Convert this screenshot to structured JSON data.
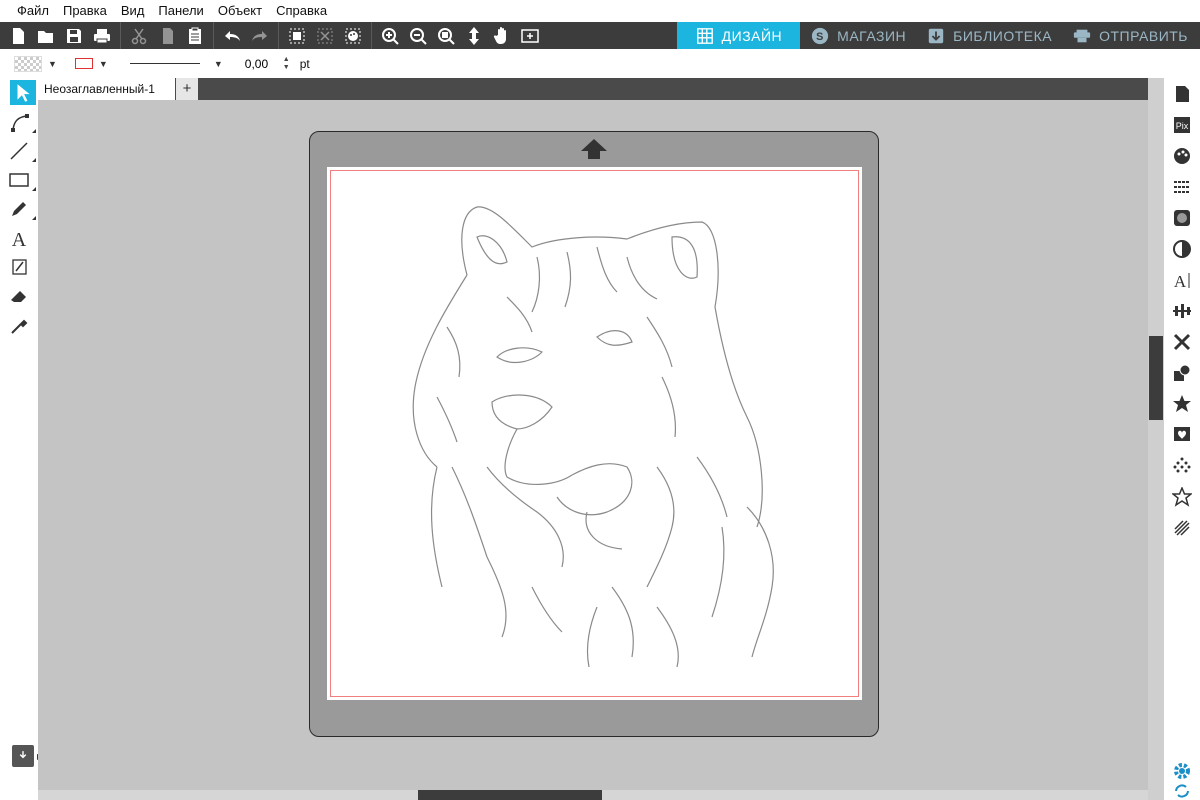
{
  "menu": [
    "Файл",
    "Правка",
    "Вид",
    "Панели",
    "Объект",
    "Справка"
  ],
  "toolbar": {
    "groups": [
      [
        "new-icon",
        "open-icon",
        "save-icon",
        "print-icon"
      ],
      [
        "cut-icon",
        "copy-icon",
        "paste-icon"
      ],
      [
        "undo-icon",
        "redo-icon"
      ],
      [
        "group-icon",
        "ungroup-icon",
        "fill-color-icon"
      ],
      [
        "zoom-in-icon",
        "zoom-out-icon",
        "zoom-select-icon",
        "drag-icon",
        "pan-icon",
        "fit-page-icon"
      ]
    ],
    "nav_tabs": [
      {
        "id": "design",
        "label": "ДИЗАЙН",
        "icon": "grid-icon",
        "active": true
      },
      {
        "id": "store",
        "label": "МАГАЗИН",
        "icon": "store-icon",
        "active": false
      },
      {
        "id": "library",
        "label": "БИБЛИОТЕКА",
        "icon": "library-icon",
        "active": false
      },
      {
        "id": "send",
        "label": "ОТПРАВИТЬ",
        "icon": "cutter-icon",
        "active": false
      }
    ],
    "active_color": "#1bb5e0"
  },
  "properties": {
    "line_width": "0,00",
    "unit": "pt",
    "line_color": "#e03030"
  },
  "document": {
    "tab_title": "Неозаглавленный-1",
    "add_tab": "+"
  },
  "left_tools": [
    "select-icon",
    "edit-points-icon",
    "line-icon",
    "rectangle-icon",
    "pencil-icon",
    "text-icon",
    "knife-icon",
    "eraser-icon",
    "eyedropper-icon"
  ],
  "right_panels": [
    "page-setup-icon",
    "pixscan-icon",
    "fill-panel-icon",
    "line-style-icon",
    "pattern-icon",
    "trace-icon",
    "text-style-icon",
    "align-icon",
    "replicate-icon",
    "modify-icon",
    "offset-icon",
    "trace-panel-icon",
    "rhinestone-icon",
    "sketch-icon",
    "emboss-icon"
  ],
  "bottom_right": [
    "settings-icon",
    "sync-icon"
  ]
}
